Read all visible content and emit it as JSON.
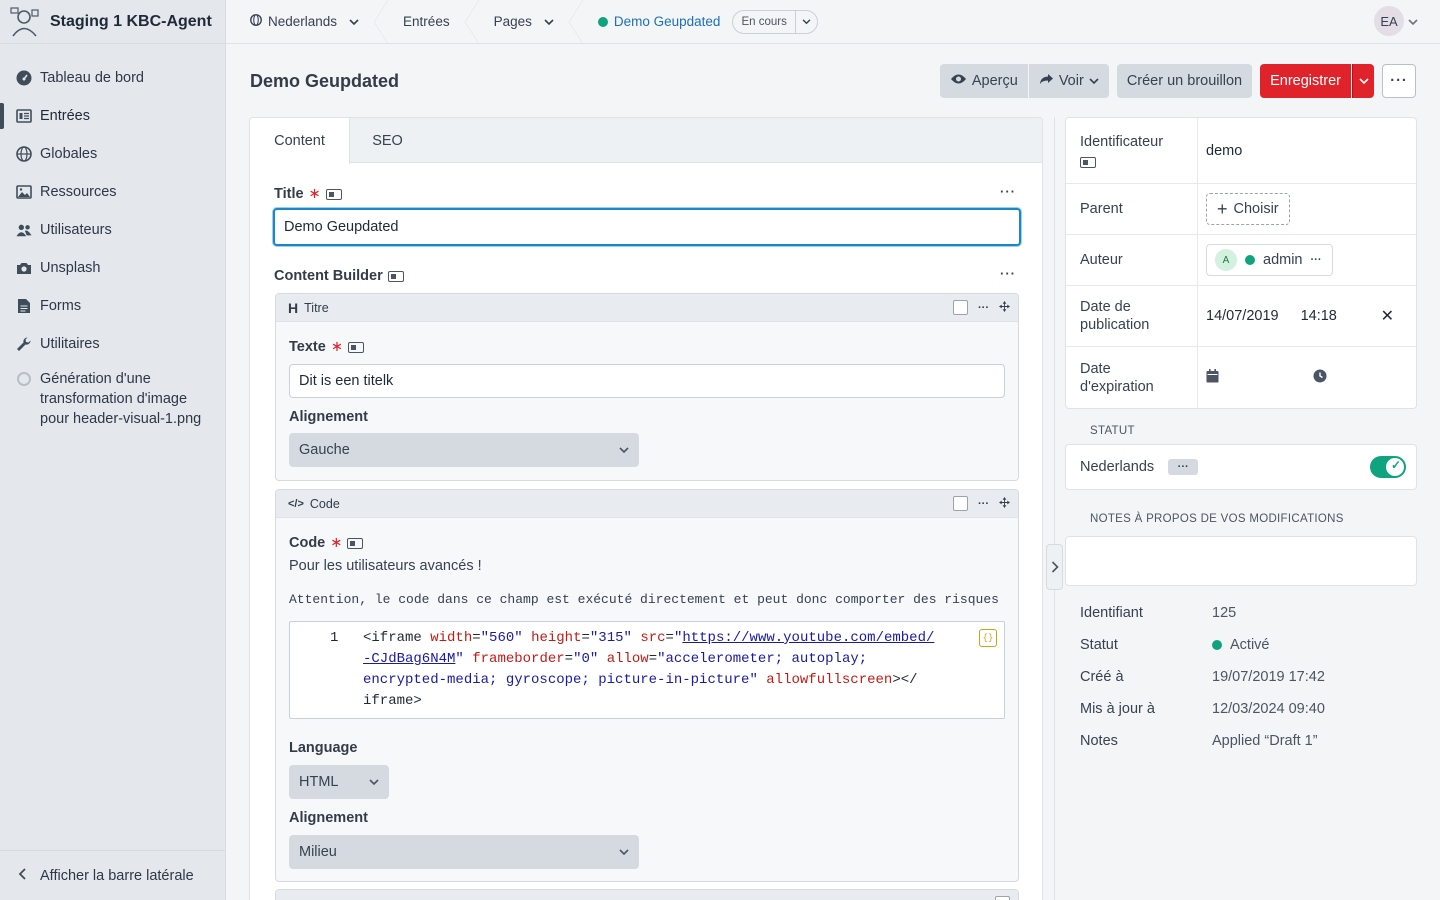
{
  "site": {
    "name": "Staging 1 KBC-Agent"
  },
  "sidebar": {
    "items": [
      {
        "label": "Tableau de bord",
        "icon": "dashboard-icon"
      },
      {
        "label": "Entrées",
        "icon": "entries-icon"
      },
      {
        "label": "Globales",
        "icon": "globe-icon"
      },
      {
        "label": "Ressources",
        "icon": "image-icon"
      },
      {
        "label": "Utilisateurs",
        "icon": "users-icon"
      },
      {
        "label": "Unsplash",
        "icon": "camera-icon"
      },
      {
        "label": "Forms",
        "icon": "document-icon"
      },
      {
        "label": "Utilitaires",
        "icon": "wrench-icon"
      },
      {
        "label": "Génération d'une transformation d'image pour header-visual-1.png",
        "icon": "progress-circle-icon"
      }
    ],
    "collapse_label": "Afficher la barre latérale"
  },
  "topbar": {
    "site_switch": "Nederlands",
    "crumb_entries": "Entrées",
    "crumb_pages": "Pages",
    "entry_title": "Demo Geupdated",
    "entry_status": "En cours",
    "user_initials": "EA"
  },
  "header": {
    "title": "Demo Geupdated",
    "preview": "Aperçu",
    "view": "Voir",
    "draft": "Créer un brouillon",
    "save": "Enregistrer"
  },
  "tabs": [
    "Content",
    "SEO"
  ],
  "fields": {
    "title_label": "Title",
    "title_value": "Demo Geupdated",
    "builder_label": "Content Builder",
    "block1": {
      "type": "Titre",
      "texte_label": "Texte",
      "texte_value": "Dit is een titelk",
      "align_label": "Alignement",
      "align_value": "Gauche"
    },
    "block2": {
      "type": "Code",
      "code_label": "Code",
      "instructions": "Pour les utilisateurs avancés !",
      "warning": "Attention, le code dans ce champ est exécuté directement et peut donc comporter des risques de",
      "line_number": "1",
      "code": {
        "t1": "<iframe",
        "a1": "width",
        "v1": "\"560\"",
        "a2": "height",
        "v2": "\"315\"",
        "a3": "src",
        "v3q": "\"",
        "v3": "https://www.youtube.com/embed/",
        "v3b": "-CJdBag6N4M",
        "a4": "frameborder",
        "v4": "\"0\"",
        "a5": "allow",
        "v5": "\"accelerometer; autoplay;",
        "v5b": "encrypted-media; gyroscope; picture-in-picture\"",
        "a6": "allowfullscreen",
        "t2": "></",
        "t3": "iframe>"
      },
      "lang_label": "Language",
      "lang_value": "HTML",
      "align_label": "Alignement",
      "align_value": "Milieu"
    }
  },
  "meta": {
    "slug_label": "Identificateur",
    "slug_value": "demo",
    "parent_label": "Parent",
    "parent_button": "Choisir",
    "author_label": "Auteur",
    "author_initial": "A",
    "author_name": "admin",
    "postdate_label": "Date de publication",
    "postdate_date": "14/07/2019",
    "postdate_time": "14:18",
    "expiry_label": "Date d'expiration"
  },
  "status_section": {
    "heading": "STATUT",
    "site": "Nederlands",
    "enabled": true
  },
  "notes_section": {
    "heading": "NOTES À PROPOS DE VOS MODIFICATIONS"
  },
  "info": [
    {
      "key": "Identifiant",
      "value": "125"
    },
    {
      "key": "Statut",
      "value": "Activé"
    },
    {
      "key": "Créé à",
      "value": "19/07/2019 17:42"
    },
    {
      "key": "Mis à jour à",
      "value": "12/03/2024 09:40"
    },
    {
      "key": "Notes",
      "value": "Applied “Draft 1”"
    }
  ],
  "colors": {
    "accent_red": "#e0232b",
    "status_green": "#10a37f",
    "focus_blue": "#1b87c9"
  }
}
